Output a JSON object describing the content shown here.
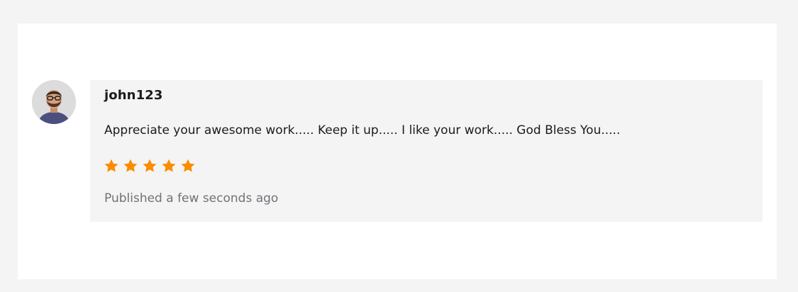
{
  "review": {
    "username": "john123",
    "text": "Appreciate your awesome work..... Keep it up..... I like your work..... God Bless You.....",
    "rating": 5,
    "rating_max": 5,
    "published": "Published a few seconds ago"
  },
  "colors": {
    "star": "#fb8c00",
    "page_bg": "#f4f4f4",
    "card_bg": "#ffffff",
    "review_bg": "#f4f4f4"
  },
  "icons": {
    "avatar": "user-avatar",
    "star": "star-icon"
  }
}
